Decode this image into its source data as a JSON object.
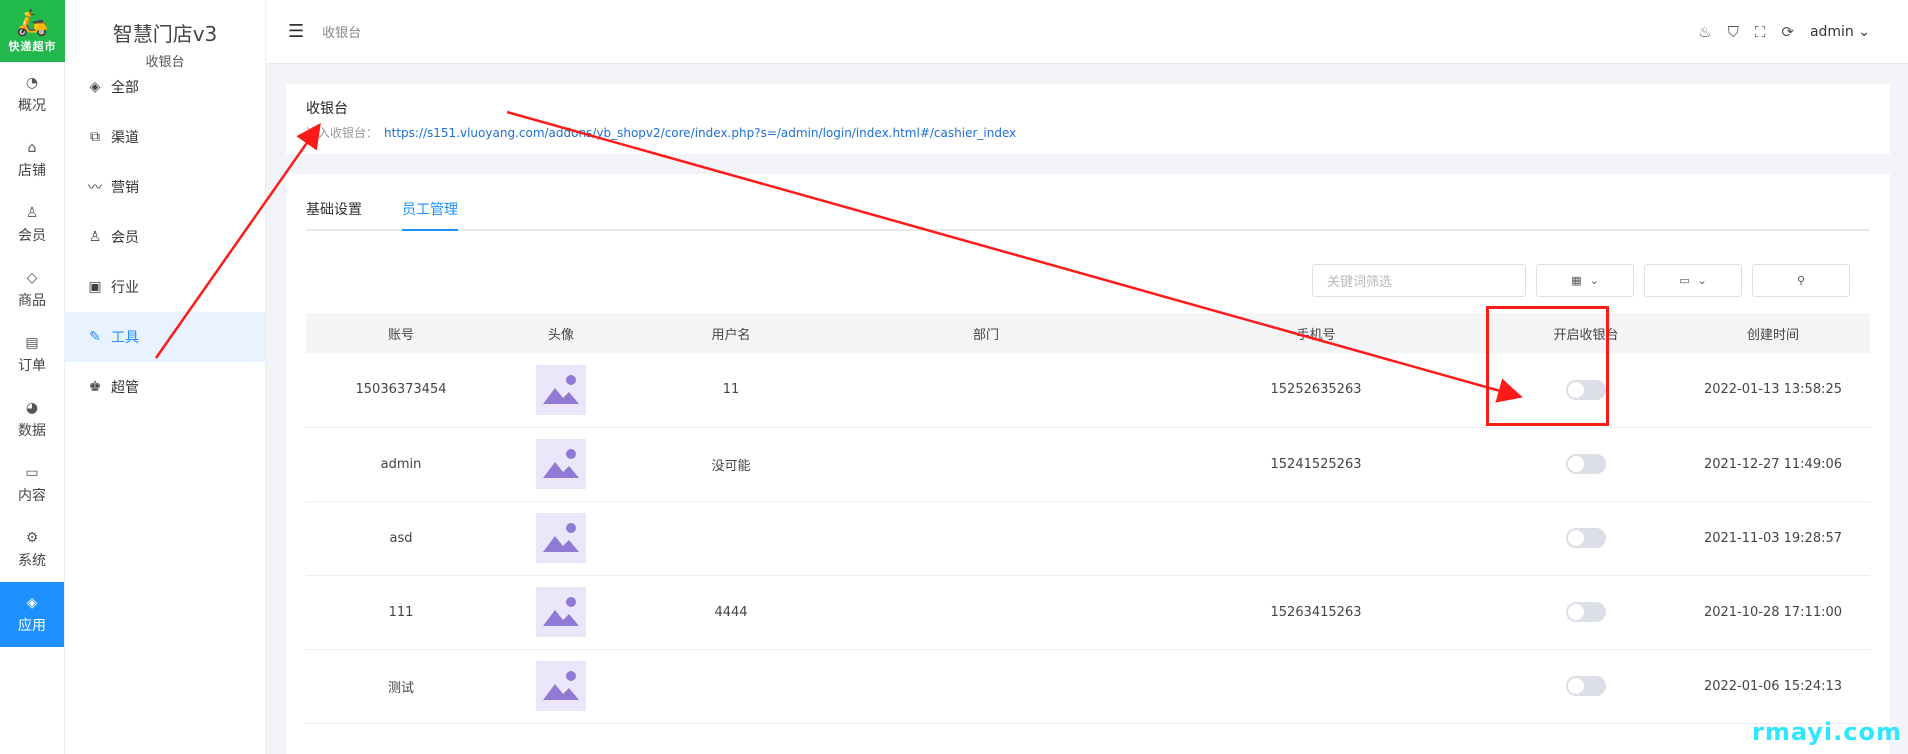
{
  "app": {
    "logo_text": "快递超市",
    "title": "智慧门店v3",
    "subtitle": "收银台"
  },
  "rail": [
    {
      "label": "概况",
      "icon": "dashboard-icon",
      "glyph": "◔"
    },
    {
      "label": "店铺",
      "icon": "store-icon",
      "glyph": "⌂"
    },
    {
      "label": "会员",
      "icon": "user-icon",
      "glyph": "♙"
    },
    {
      "label": "商品",
      "icon": "box-icon",
      "glyph": "◇"
    },
    {
      "label": "订单",
      "icon": "clipboard-icon",
      "glyph": "▤"
    },
    {
      "label": "数据",
      "icon": "pie-chart-icon",
      "glyph": "◕"
    },
    {
      "label": "内容",
      "icon": "folder-icon",
      "glyph": "▭"
    },
    {
      "label": "系统",
      "icon": "gear-icon",
      "glyph": "⚙"
    },
    {
      "label": "应用",
      "icon": "cube-icon",
      "glyph": "◈",
      "active": true
    }
  ],
  "sidebar": [
    {
      "label": "全部",
      "icon": "cube-icon",
      "glyph": "◈"
    },
    {
      "label": "渠道",
      "icon": "channel-icon",
      "glyph": "⧉"
    },
    {
      "label": "营销",
      "icon": "trend-icon",
      "glyph": "〰"
    },
    {
      "label": "会员",
      "icon": "user-icon",
      "glyph": "♙"
    },
    {
      "label": "行业",
      "icon": "briefcase-icon",
      "glyph": "▣"
    },
    {
      "label": "工具",
      "icon": "wrench-icon",
      "glyph": "✎",
      "active": true
    },
    {
      "label": "超管",
      "icon": "admin-icon",
      "glyph": "♚"
    }
  ],
  "header": {
    "breadcrumb": "收银台",
    "user": "admin",
    "icons": [
      "broom-icon",
      "shirt-icon",
      "fullscreen-icon",
      "refresh-icon"
    ]
  },
  "info": {
    "title": "收银台",
    "link_label": "进入收银台：",
    "link_url": "https://s151.vluoyang.com/addons/yb_shopv2/core/index.php?s=/admin/login/index.html#/cashier_index"
  },
  "tabs": [
    {
      "label": "基础设置",
      "active": false
    },
    {
      "label": "员工管理",
      "active": true
    }
  ],
  "filters": {
    "keyword_placeholder": "关键词筛选"
  },
  "table": {
    "headers": [
      "账号",
      "头像",
      "用户名",
      "部门",
      "手机号",
      "开启收银台",
      "创建时间"
    ],
    "rows": [
      {
        "account": "15036373454",
        "username": "11",
        "department": "",
        "phone": "15252635263",
        "cashier_enabled": false,
        "created": "2022-01-13 13:58:25"
      },
      {
        "account": "admin",
        "username": "没可能",
        "department": "",
        "phone": "15241525263",
        "cashier_enabled": false,
        "created": "2021-12-27 11:49:06"
      },
      {
        "account": "asd",
        "username": "",
        "department": "",
        "phone": "",
        "cashier_enabled": false,
        "created": "2021-11-03 19:28:57"
      },
      {
        "account": "111",
        "username": "4444",
        "department": "",
        "phone": "15263415263",
        "cashier_enabled": false,
        "created": "2021-10-28 17:11:00"
      },
      {
        "account": "测试",
        "username": "",
        "department": "",
        "phone": "",
        "cashier_enabled": false,
        "created": "2022-01-06 15:24:13"
      }
    ]
  },
  "watermark": "rmayi.com",
  "colors": {
    "accent": "#1e90ff",
    "logo_bg": "#21b94c",
    "annotation": "#ff1a1a",
    "watermark": "#2ee6ff"
  }
}
